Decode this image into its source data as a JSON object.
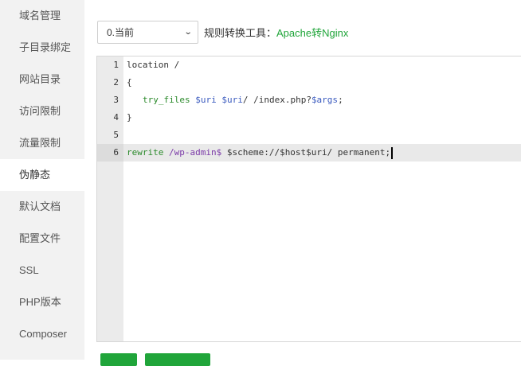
{
  "sidebar": {
    "items": [
      {
        "label": "域名管理"
      },
      {
        "label": "子目录绑定"
      },
      {
        "label": "网站目录"
      },
      {
        "label": "访问限制"
      },
      {
        "label": "流量限制"
      },
      {
        "label": "伪静态"
      },
      {
        "label": "默认文档"
      },
      {
        "label": "配置文件"
      },
      {
        "label": "SSL"
      },
      {
        "label": "PHP版本"
      },
      {
        "label": "Composer"
      }
    ],
    "active": "伪静态"
  },
  "toolbar": {
    "select_value": "0.当前",
    "tool_label": "规则转换工具：",
    "tool_link": "Apache转Nginx"
  },
  "editor": {
    "line_numbers": [
      "1",
      "2",
      "3",
      "4",
      "5",
      "6"
    ],
    "lines": {
      "l1": "location /",
      "l2": "{",
      "l3": {
        "a": "try_files",
        "b": " $uri $uri",
        "c": "/ /index.php?",
        "d": "$args",
        "e": ";"
      },
      "l4": "}",
      "l5": "",
      "l6": {
        "a": "rewrite",
        "b": " /wp-admin$",
        "c": " $scheme://$host$uri/ permanent;"
      }
    }
  }
}
